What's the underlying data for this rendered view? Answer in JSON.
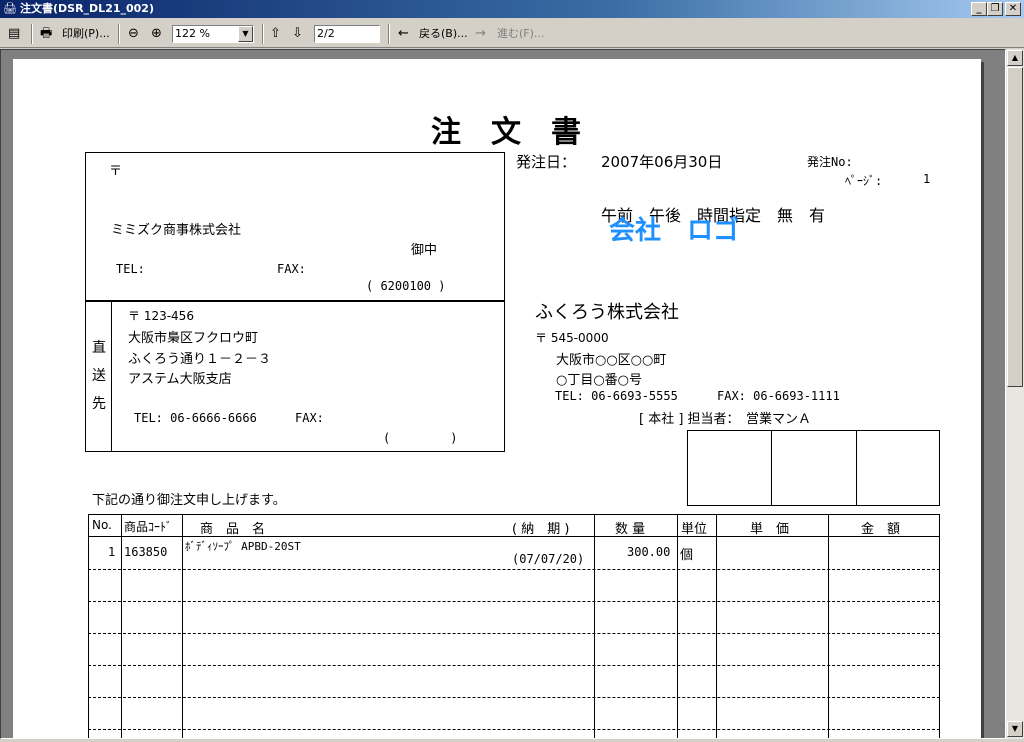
{
  "window": {
    "title": "注文書(DSR_DL21_002)",
    "title_icon": "printer-document-icon",
    "minimize": "_",
    "maximize": "❐",
    "close": "✕"
  },
  "toolbar": {
    "print_label": "印刷(P)...",
    "zoom_value": "122 %",
    "page_value": "2/2",
    "back_label": "戻る(B)...",
    "forward_label": "進む(F)..."
  },
  "document": {
    "title": "注　文　書",
    "order_date_label": "発注日：",
    "order_date": "2007年06月30日",
    "order_no_label": "発注No:",
    "page_label": "ﾍﾟｰｼﾞ:",
    "page_num": "1",
    "time_options": "午前　午後　時間指定　無　有",
    "logo_text": "会社　ロゴ",
    "recipient": {
      "postal_mark": "〒",
      "name": "ミミズク商事株式会社",
      "honorific": "御中",
      "tel_label": "TEL:",
      "fax_label": "FAX:",
      "code": "( 6200100 )"
    },
    "direct": {
      "label_1": "直",
      "label_2": "送",
      "label_3": "先",
      "postal": "〒 123-456",
      "address_1": "大阪市梟区フクロウ町",
      "address_2": "ふくろう通り１－２－３",
      "branch": "アステム大阪支店",
      "tel": "TEL: 06-6666-6666",
      "fax_label": "FAX:",
      "paren": "(　　　　　)"
    },
    "sender": {
      "company": "ふくろう株式会社",
      "postal": "〒 545-0000",
      "address_1": "大阪市○○区○○町",
      "address_2": "○丁目○番○号",
      "tel": "TEL:  06-6693-5555",
      "fax": "FAX:  06-6693-1111",
      "staff": "[ 本社 ] 担当者：　営業マンＡ"
    },
    "intro": "下記の通り御注文申し上げます。",
    "table": {
      "headers": {
        "no": "No.",
        "code": "商品ｺｰﾄﾞ",
        "name": "商　品　名",
        "delivery": "( 納　期 )",
        "qty": "数 量",
        "unit": "単位",
        "price": "単　価",
        "amount": "金　額"
      },
      "rows": [
        {
          "no": "1",
          "code": "163850",
          "name": "ﾎﾞﾃﾞｨｿｰﾌﾟ APBD-20ST",
          "delivery": "(07/07/20)",
          "qty": "300.00",
          "unit": "個",
          "price": "",
          "amount": ""
        }
      ]
    }
  }
}
